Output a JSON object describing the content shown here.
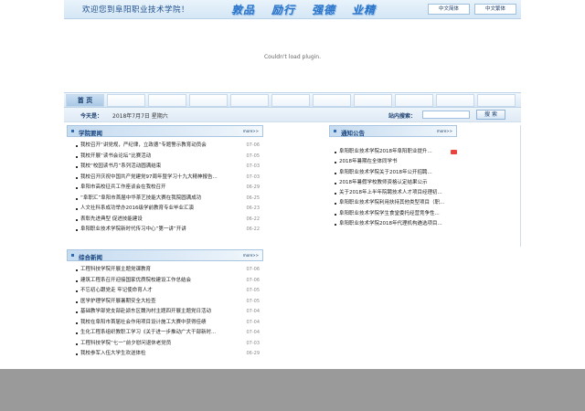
{
  "header": {
    "welcome": "欢迎您到阜阳职业技术学院！",
    "motto": [
      "敦品",
      "励行",
      "强德",
      "业精"
    ],
    "lang_simplified": "中文简体",
    "lang_traditional": "中文繁体"
  },
  "plugin_message": "Couldn't load plugin.",
  "nav": {
    "home": "首  页"
  },
  "datebar": {
    "today_label": "今天是：",
    "date": "2018年7月7日 星期六",
    "search_label": "站内搜索：",
    "search_value": "",
    "search_button": "搜  索"
  },
  "news": {
    "title": "学院要闻",
    "more": "more>>",
    "items": [
      {
        "title": "我校召开“讲党规，严纪律，立政德”专题警示教育动员会",
        "date": "07-06"
      },
      {
        "title": "我校开展“读书会论坛”比赛活动",
        "date": "07-05"
      },
      {
        "title": "我校“校园读书月”系列活动圆满结束",
        "date": "07-03"
      },
      {
        "title": "我校召开庆祝中国共产党建党97周年暨学习十九大精神报告...",
        "date": "07-03"
      },
      {
        "title": "阜阳市高校征兵工作座谈会在我校召开",
        "date": "06-29"
      },
      {
        "title": "“阜职汇”阜阳市首届中华茶艺技能大赛在我院圆满成功",
        "date": "06-25"
      },
      {
        "title": "人文社科系成功举办2016级学前教育专业毕业汇演",
        "date": "06-23"
      },
      {
        "title": "表彰先进典型 促进技能建设",
        "date": "06-22"
      },
      {
        "title": "阜阳职业技术学院新时代传习中心“第一讲”开讲",
        "date": "06-22"
      }
    ]
  },
  "general": {
    "title": "综合新闻",
    "more": "more>>",
    "items": [
      {
        "title": "工程科技学院开展主题党课教育",
        "date": "07-06"
      },
      {
        "title": "建筑工程系召开迎接国家优质院校建设工作总结会",
        "date": "07-06"
      },
      {
        "title": "不忘初心跟党走 牢记使命育人才",
        "date": "07-05"
      },
      {
        "title": "医学护理学院开展暑期安全大检查",
        "date": "07-05"
      },
      {
        "title": "基础教学部党支部赴颍东区魏沟村主题四开展主题党日活动",
        "date": "07-04"
      },
      {
        "title": "我校在阜阳市首届社会作用项目设计施工大赛中获得佳绩",
        "date": "07-04"
      },
      {
        "title": "生化工程系组织教职工学习《关于进一步推动广大干部新时...",
        "date": "07-04"
      },
      {
        "title": "工程科技学院“七一”前夕慰问退休老党员",
        "date": "07-03"
      },
      {
        "title": "我校参军入伍大学生欢送体检",
        "date": "06-29"
      }
    ]
  },
  "notices": {
    "title": "通知公告",
    "more": "more>>",
    "items": [
      {
        "title": "阜阳职业技术学院2018年阜阳职业提升...",
        "is_new": true
      },
      {
        "title": "2018年暑期在全体同学书",
        "is_new": false
      },
      {
        "title": "阜阳职业技术学院关于2018年公开招聘...",
        "is_new": false
      },
      {
        "title": "2018年暑假学校教师资格认定结果公示",
        "is_new": false
      },
      {
        "title": "关于2018年上半年院聘技术人才项目经理初...",
        "is_new": false
      },
      {
        "title": "阜阳职业技术学院利用扶持其他类型项目（职...",
        "is_new": false
      },
      {
        "title": "阜阳职业技术学院学生食堂委托经营竞争性...",
        "is_new": false
      },
      {
        "title": "阜阳职业技术学院2018年代理机构遴选项目...",
        "is_new": false
      }
    ]
  }
}
